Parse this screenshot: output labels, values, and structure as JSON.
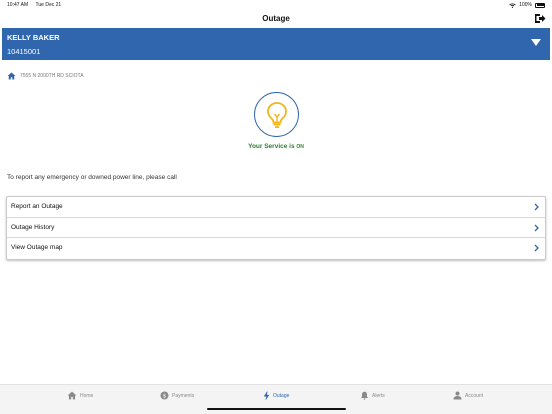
{
  "status_bar": {
    "time": "10:47 AM",
    "date": "Tue Dec 21",
    "battery": "100%"
  },
  "nav": {
    "title": "Outage"
  },
  "account": {
    "name": "KELLY BAKER",
    "number": "10415001"
  },
  "address": {
    "text": "7555 N 2000TH RD SCIOTA"
  },
  "service": {
    "prefix": "Your Service is ",
    "state": "ON"
  },
  "instructions": {
    "text": "To report any emergency or downed power line, please call"
  },
  "actions": [
    {
      "label": "Report an Outage"
    },
    {
      "label": "Outage History"
    },
    {
      "label": "View Outage map"
    }
  ],
  "tabs": [
    {
      "label": "Home",
      "icon": "home-icon"
    },
    {
      "label": "Payments",
      "icon": "dollar-icon"
    },
    {
      "label": "Outage",
      "icon": "lightning-icon"
    },
    {
      "label": "Alerts",
      "icon": "bell-icon"
    },
    {
      "label": "Account",
      "icon": "person-icon"
    }
  ],
  "colors": {
    "accent": "#2f66ad",
    "status_on": "#2e7d32",
    "bulb": "#f2b51c"
  }
}
